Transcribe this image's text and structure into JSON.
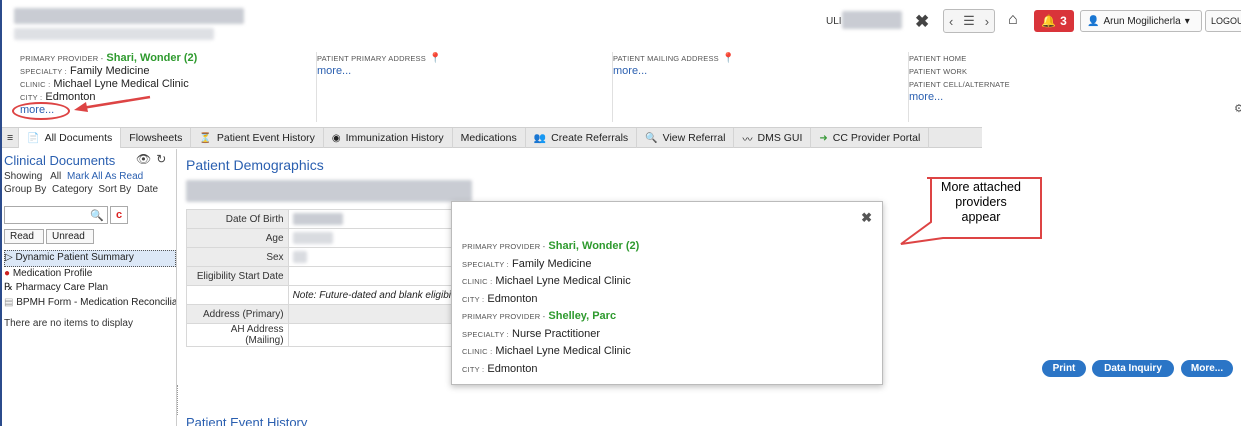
{
  "header": {
    "uli_label": "ULI",
    "alert_count": "3",
    "user_name": "Arun Mogilicherla",
    "logout_label": "LOGOUT"
  },
  "info": {
    "provider_label": "PRIMARY PROVIDER -",
    "provider_name": "Shari, Wonder (2)",
    "specialty_label": "SPECIALTY :",
    "specialty_value": "Family Medicine",
    "clinic_label": "CLINIC :",
    "clinic_value": "Michael Lyne Medical Clinic",
    "city_label": "CITY :",
    "city_value": "Edmonton",
    "more_link": "more...",
    "primary_address_label": "PATIENT PRIMARY ADDRESS",
    "primary_address_more": "more...",
    "mailing_address_label": "PATIENT MAILING ADDRESS",
    "mailing_address_more": "more...",
    "home_label": "PATIENT HOME",
    "work_label": "PATIENT WORK",
    "cell_label": "PATIENT CELL/ALTERNATE",
    "phone_more": "more..."
  },
  "tabs": [
    {
      "label": "All Documents"
    },
    {
      "label": "Flowsheets"
    },
    {
      "label": "Patient Event History"
    },
    {
      "label": "Immunization History"
    },
    {
      "label": "Medications"
    },
    {
      "label": "Create Referrals"
    },
    {
      "label": "View Referral"
    },
    {
      "label": "DMS GUI"
    },
    {
      "label": "CC Provider Portal"
    }
  ],
  "left_panel": {
    "title": "Clinical Documents",
    "showing_label": "Showing",
    "showing_all": "All",
    "mark_all_read": "Mark All As Read",
    "group_by_label": "Group By",
    "group_by_value": "Category",
    "sort_by_label": "Sort By",
    "sort_by_value": "Date",
    "read_btn": "Read",
    "unread_btn": "Unread",
    "items": [
      "Dynamic Patient Summary",
      "Medication Profile",
      "Pharmacy Care Plan",
      "BPMH Form - Medication Reconcilia"
    ],
    "no_items": "There are no items to display"
  },
  "main": {
    "title": "Patient Demographics",
    "rows": [
      {
        "k": "Date Of Birth"
      },
      {
        "k": "Age"
      },
      {
        "k": "Sex"
      },
      {
        "k": "Eligibility Start Date"
      },
      {
        "k": ""
      },
      {
        "k": "Address (Primary)"
      },
      {
        "k": "AH Address (Mailing)"
      }
    ],
    "note": "Note: Future-dated and blank eligibi",
    "event_history_title": "Patient Event History"
  },
  "popup": {
    "p1_label": "PRIMARY PROVIDER -",
    "p1_name": "Shari, Wonder (2)",
    "p1_specialty_label": "SPECIALTY :",
    "p1_specialty": "Family Medicine",
    "p1_clinic_label": "CLINIC :",
    "p1_clinic": "Michael Lyne Medical Clinic",
    "p1_city_label": "CITY :",
    "p1_city": "Edmonton",
    "p2_label": "PRIMARY PROVIDER -",
    "p2_name": "Shelley, Parc",
    "p2_specialty_label": "SPECIALTY :",
    "p2_specialty": "Nurse Practitioner",
    "p2_clinic_label": "CLINIC :",
    "p2_clinic": "Michael Lyne Medical Clinic",
    "p2_city_label": "CITY :",
    "p2_city": "Edmonton"
  },
  "callout": {
    "line1": "More attached",
    "line2": "providers",
    "line3": "appear"
  },
  "buttons": {
    "print": "Print",
    "data_inquiry": "Data Inquiry",
    "more": "More..."
  },
  "colors": {
    "link": "#2a5fb0",
    "provider_green": "#2e9a2e",
    "alert_red": "#d9343a",
    "button_blue": "#2b75c6"
  }
}
